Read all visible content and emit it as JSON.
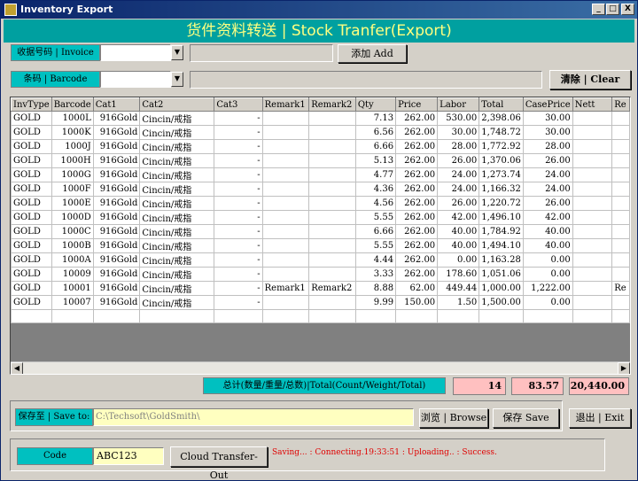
{
  "window": {
    "title": "Inventory Export",
    "min": "_",
    "max": "□",
    "close": "X"
  },
  "banner": "货件资料转送 | Stock Tranfer(Export)",
  "invoice": {
    "label": "收据号码 | Invoice",
    "value": "",
    "add_label": "添加 Add"
  },
  "barcode": {
    "label": "条码 | Barcode",
    "value": "",
    "clear_label": "清除 | Clear"
  },
  "grid": {
    "columns": [
      "InvType",
      "Barcode",
      "Cat1",
      "Cat2",
      "Cat3",
      "Remark1",
      "Remark2",
      "Qty",
      "Price",
      "Labor",
      "Total",
      "CasePrice",
      "Nett",
      "Re"
    ],
    "rows": [
      [
        "GOLD",
        "1000L",
        "916Gold",
        "Cincin/戒指",
        "-",
        "",
        "",
        "7.13",
        "262.00",
        "530.00",
        "2,398.06",
        "30.00",
        "",
        ""
      ],
      [
        "GOLD",
        "1000K",
        "916Gold",
        "Cincin/戒指",
        "-",
        "",
        "",
        "6.56",
        "262.00",
        "30.00",
        "1,748.72",
        "30.00",
        "",
        ""
      ],
      [
        "GOLD",
        "1000J",
        "916Gold",
        "Cincin/戒指",
        "-",
        "",
        "",
        "6.66",
        "262.00",
        "28.00",
        "1,772.92",
        "28.00",
        "",
        ""
      ],
      [
        "GOLD",
        "1000H",
        "916Gold",
        "Cincin/戒指",
        "-",
        "",
        "",
        "5.13",
        "262.00",
        "26.00",
        "1,370.06",
        "26.00",
        "",
        ""
      ],
      [
        "GOLD",
        "1000G",
        "916Gold",
        "Cincin/戒指",
        "-",
        "",
        "",
        "4.77",
        "262.00",
        "24.00",
        "1,273.74",
        "24.00",
        "",
        ""
      ],
      [
        "GOLD",
        "1000F",
        "916Gold",
        "Cincin/戒指",
        "-",
        "",
        "",
        "4.36",
        "262.00",
        "24.00",
        "1,166.32",
        "24.00",
        "",
        ""
      ],
      [
        "GOLD",
        "1000E",
        "916Gold",
        "Cincin/戒指",
        "-",
        "",
        "",
        "4.56",
        "262.00",
        "26.00",
        "1,220.72",
        "26.00",
        "",
        ""
      ],
      [
        "GOLD",
        "1000D",
        "916Gold",
        "Cincin/戒指",
        "-",
        "",
        "",
        "5.55",
        "262.00",
        "42.00",
        "1,496.10",
        "42.00",
        "",
        ""
      ],
      [
        "GOLD",
        "1000C",
        "916Gold",
        "Cincin/戒指",
        "-",
        "",
        "",
        "6.66",
        "262.00",
        "40.00",
        "1,784.92",
        "40.00",
        "",
        ""
      ],
      [
        "GOLD",
        "1000B",
        "916Gold",
        "Cincin/戒指",
        "-",
        "",
        "",
        "5.55",
        "262.00",
        "40.00",
        "1,494.10",
        "40.00",
        "",
        ""
      ],
      [
        "GOLD",
        "1000A",
        "916Gold",
        "Cincin/戒指",
        "-",
        "",
        "",
        "4.44",
        "262.00",
        "0.00",
        "1,163.28",
        "0.00",
        "",
        ""
      ],
      [
        "GOLD",
        "10009",
        "916Gold",
        "Cincin/戒指",
        "-",
        "",
        "",
        "3.33",
        "262.00",
        "178.60",
        "1,051.06",
        "0.00",
        "",
        ""
      ],
      [
        "GOLD",
        "10001",
        "916Gold",
        "Cincin/戒指",
        "-",
        "Remark1",
        "Remark2",
        "8.88",
        "62.00",
        "449.44",
        "1,000.00",
        "1,222.00",
        "",
        "Re"
      ],
      [
        "GOLD",
        "10007",
        "916Gold",
        "Cincin/戒指",
        "-",
        "",
        "",
        "9.99",
        "150.00",
        "1.50",
        "1,500.00",
        "0.00",
        "",
        ""
      ]
    ]
  },
  "summary": {
    "label": "总计(数量/重量/总数)|Total(Count/Weight/Total)",
    "count": "14",
    "weight": "83.57",
    "total": "20,440.00"
  },
  "save": {
    "label": "保存至 | Save to:",
    "path": "C:\\Techsoft\\GoldSmith\\",
    "browse_label": "浏览 | Browse",
    "save_label": "保存 Save",
    "exit_label": "退出 | Exit"
  },
  "cloud": {
    "code_label": "Code",
    "code_value": "ABC123",
    "transfer_label": "Cloud Transfer-Out",
    "status": "Saving... : Connecting.19:33:51 : Uploading.. : Success."
  }
}
